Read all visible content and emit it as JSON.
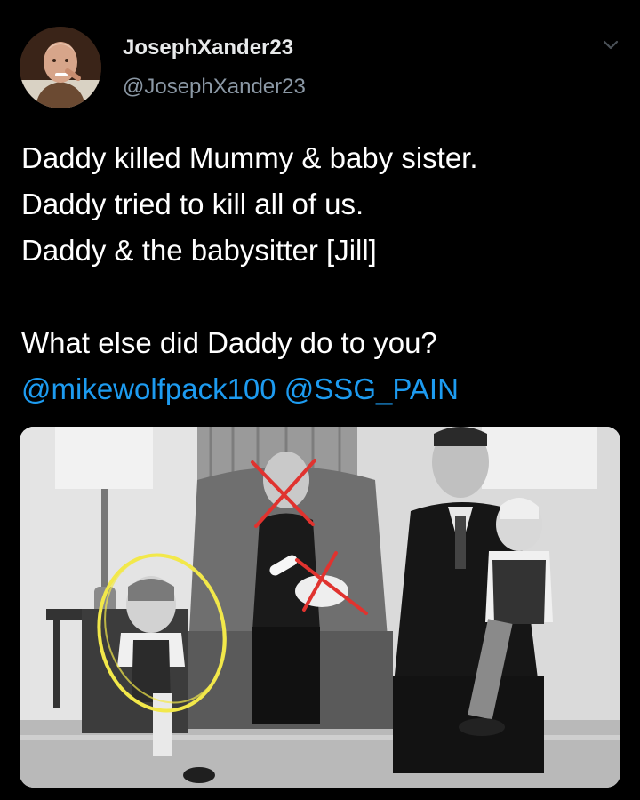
{
  "author": {
    "display_name": "JosephXander23",
    "handle": "@JosephXander23",
    "avatar_icon": "profile-photo"
  },
  "tweet": {
    "lines": [
      "Daddy killed Mummy & baby sister.",
      "Daddy tried to kill all of us.",
      "Daddy & the babysitter [Jill]",
      "What else did Daddy do to you?"
    ],
    "mentions": [
      "@mikewolfpack100",
      "@SSG_PAIN"
    ]
  },
  "menu_icon": "chevron-down-icon",
  "photo": {
    "style": "black-and-white family portrait",
    "annotations": {
      "cross_color": "#e0332f",
      "circle_color": "#f2e84a"
    }
  },
  "colors": {
    "background": "#000000",
    "text": "#ffffff",
    "secondary": "#8b98a5",
    "link": "#1d9bf0"
  }
}
